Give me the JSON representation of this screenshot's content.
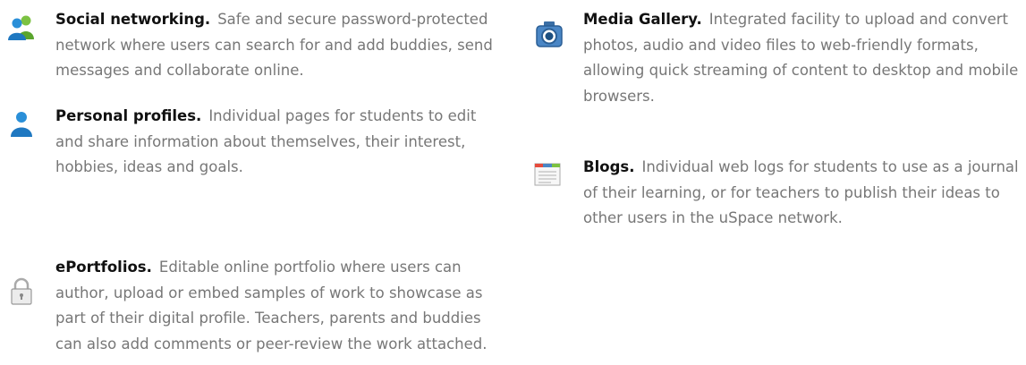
{
  "features_left": [
    {
      "icon": "users-icon",
      "title": "Social networking.",
      "desc": "Safe and secure password-protected network where users can search for and add buddies, send messages and collaborate online."
    },
    {
      "icon": "user-icon",
      "title": "Personal profiles.",
      "desc": "Individual pages for students to edit and share information about themselves, their interest, hobbies, ideas and goals."
    },
    {
      "icon": "lock-icon",
      "title": "ePortfolios.",
      "desc": "Editable online portfolio where users can author, upload or embed samples of work to showcase as part of their digital profile. Teachers, parents and buddies can also add comments or peer-review the work attached."
    }
  ],
  "features_right": [
    {
      "icon": "camera-icon",
      "title": "Media Gallery.",
      "desc": "Integrated facility to upload and convert photos, audio and video files to web-friendly formats, allowing quick streaming of content to desktop and mobile browsers."
    },
    {
      "icon": "blog-icon",
      "title": "Blogs.",
      "desc": "Individual web logs for students to use as a journal of their learning, or for teachers to publish their ideas to other users in the uSpace network."
    }
  ]
}
